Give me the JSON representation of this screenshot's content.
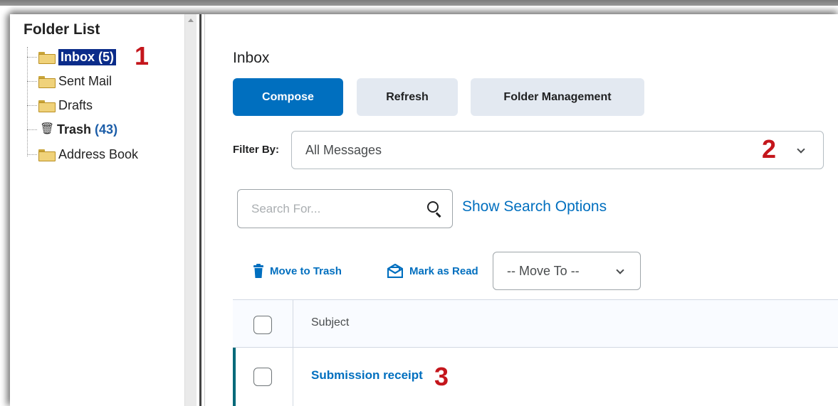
{
  "folder_list": {
    "title": "Folder List",
    "items": [
      {
        "label": "Inbox",
        "count": "(5)",
        "icon": "folder-icon",
        "selected": true
      },
      {
        "label": "Sent Mail",
        "count": "",
        "icon": "folder-icon"
      },
      {
        "label": "Drafts",
        "count": "",
        "icon": "folder-icon"
      },
      {
        "label": "Trash",
        "count": "(43)",
        "icon": "trash-icon"
      },
      {
        "label": "Address Book",
        "count": "",
        "icon": "folder-icon"
      }
    ]
  },
  "annotations": {
    "one": "1",
    "two": "2",
    "three": "3"
  },
  "main": {
    "title": "Inbox",
    "buttons": {
      "compose": "Compose",
      "refresh": "Refresh",
      "folder_management": "Folder Management"
    },
    "filter": {
      "label": "Filter By:",
      "value": "All Messages"
    },
    "search": {
      "placeholder": "Search For...",
      "options_link": "Show Search Options"
    },
    "actions": {
      "move_to_trash": "Move to Trash",
      "mark_as_read": "Mark as Read",
      "move_to": "-- Move To --"
    },
    "table": {
      "header_subject": "Subject",
      "rows": [
        {
          "subject": "Submission receipt"
        }
      ]
    }
  },
  "colors": {
    "accent": "#006fbf",
    "selected_folder_bg": "#0b2c8a",
    "annotation": "#c4161c",
    "row_accent": "#00697a"
  }
}
